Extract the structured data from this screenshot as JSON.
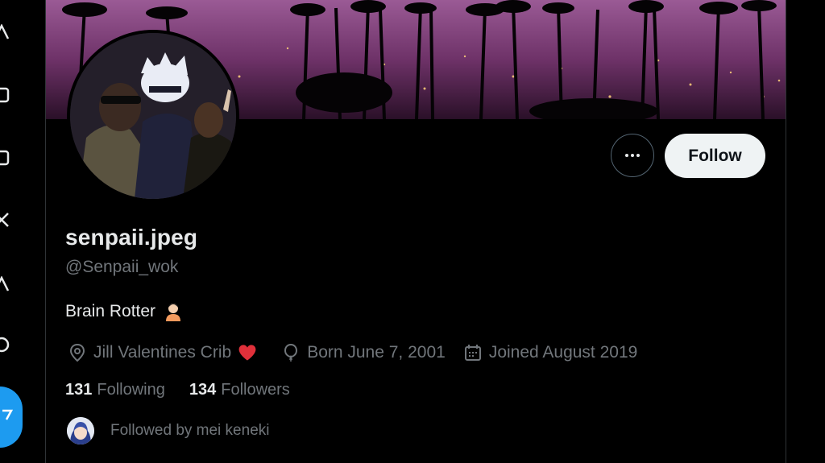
{
  "profile": {
    "display_name": "senpaii.jpeg",
    "handle": "@Senpaii_wok",
    "bio": "Brain Rotter",
    "location": "Jill Valentines Crib",
    "birthday": "Born June 7, 2001",
    "joined": "Joined August 2019"
  },
  "actions": {
    "follow_label": "Follow",
    "more_icon": "more-dots-icon"
  },
  "stats": {
    "following_count": "131",
    "following_label": "Following",
    "followers_count": "134",
    "followers_label": "Followers"
  },
  "followed_by": {
    "text": "Followed by mei keneki"
  },
  "icons": {
    "location": "location-pin-icon",
    "birthday": "balloon-icon",
    "joined": "calendar-icon",
    "bio_emoji": "person-emoji-icon",
    "heart": "red-heart-icon"
  },
  "colors": {
    "background": "#000000",
    "primary_text": "#e7e9ea",
    "secondary_text": "#71767b",
    "follow_button_bg": "#eff3f4",
    "accent_blue": "#1d9bf0",
    "heart_red": "#e0303a"
  }
}
